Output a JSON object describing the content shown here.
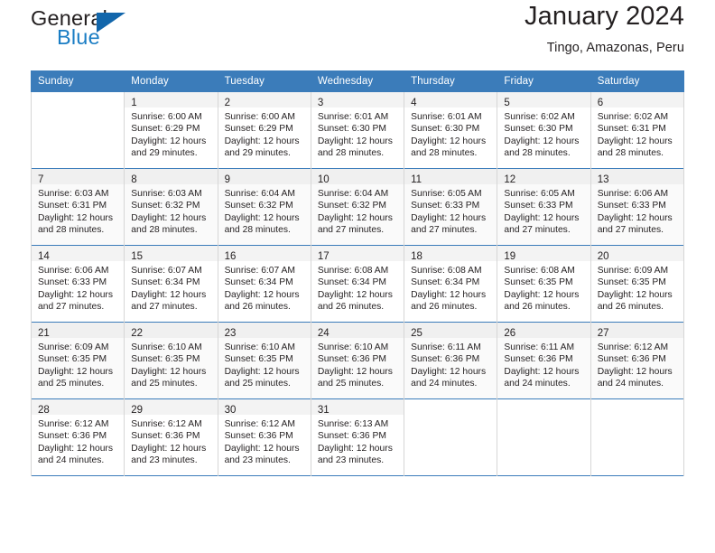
{
  "brand": {
    "word_one": "General",
    "word_two": "Blue",
    "logo_icon": "blue-triangle-logo"
  },
  "header": {
    "month_title": "January 2024",
    "location": "Tingo, Amazonas, Peru"
  },
  "calendar": {
    "weekday_headers": [
      "Sunday",
      "Monday",
      "Tuesday",
      "Wednesday",
      "Thursday",
      "Friday",
      "Saturday"
    ],
    "accent_color": "#3b7cba",
    "weeks": [
      [
        {
          "day": "",
          "lines": []
        },
        {
          "day": "1",
          "lines": [
            "Sunrise: 6:00 AM",
            "Sunset: 6:29 PM",
            "Daylight: 12 hours",
            "and 29 minutes."
          ]
        },
        {
          "day": "2",
          "lines": [
            "Sunrise: 6:00 AM",
            "Sunset: 6:29 PM",
            "Daylight: 12 hours",
            "and 29 minutes."
          ]
        },
        {
          "day": "3",
          "lines": [
            "Sunrise: 6:01 AM",
            "Sunset: 6:30 PM",
            "Daylight: 12 hours",
            "and 28 minutes."
          ]
        },
        {
          "day": "4",
          "lines": [
            "Sunrise: 6:01 AM",
            "Sunset: 6:30 PM",
            "Daylight: 12 hours",
            "and 28 minutes."
          ]
        },
        {
          "day": "5",
          "lines": [
            "Sunrise: 6:02 AM",
            "Sunset: 6:30 PM",
            "Daylight: 12 hours",
            "and 28 minutes."
          ]
        },
        {
          "day": "6",
          "lines": [
            "Sunrise: 6:02 AM",
            "Sunset: 6:31 PM",
            "Daylight: 12 hours",
            "and 28 minutes."
          ]
        }
      ],
      [
        {
          "day": "7",
          "lines": [
            "Sunrise: 6:03 AM",
            "Sunset: 6:31 PM",
            "Daylight: 12 hours",
            "and 28 minutes."
          ]
        },
        {
          "day": "8",
          "lines": [
            "Sunrise: 6:03 AM",
            "Sunset: 6:32 PM",
            "Daylight: 12 hours",
            "and 28 minutes."
          ]
        },
        {
          "day": "9",
          "lines": [
            "Sunrise: 6:04 AM",
            "Sunset: 6:32 PM",
            "Daylight: 12 hours",
            "and 28 minutes."
          ]
        },
        {
          "day": "10",
          "lines": [
            "Sunrise: 6:04 AM",
            "Sunset: 6:32 PM",
            "Daylight: 12 hours",
            "and 27 minutes."
          ]
        },
        {
          "day": "11",
          "lines": [
            "Sunrise: 6:05 AM",
            "Sunset: 6:33 PM",
            "Daylight: 12 hours",
            "and 27 minutes."
          ]
        },
        {
          "day": "12",
          "lines": [
            "Sunrise: 6:05 AM",
            "Sunset: 6:33 PM",
            "Daylight: 12 hours",
            "and 27 minutes."
          ]
        },
        {
          "day": "13",
          "lines": [
            "Sunrise: 6:06 AM",
            "Sunset: 6:33 PM",
            "Daylight: 12 hours",
            "and 27 minutes."
          ]
        }
      ],
      [
        {
          "day": "14",
          "lines": [
            "Sunrise: 6:06 AM",
            "Sunset: 6:33 PM",
            "Daylight: 12 hours",
            "and 27 minutes."
          ]
        },
        {
          "day": "15",
          "lines": [
            "Sunrise: 6:07 AM",
            "Sunset: 6:34 PM",
            "Daylight: 12 hours",
            "and 27 minutes."
          ]
        },
        {
          "day": "16",
          "lines": [
            "Sunrise: 6:07 AM",
            "Sunset: 6:34 PM",
            "Daylight: 12 hours",
            "and 26 minutes."
          ]
        },
        {
          "day": "17",
          "lines": [
            "Sunrise: 6:08 AM",
            "Sunset: 6:34 PM",
            "Daylight: 12 hours",
            "and 26 minutes."
          ]
        },
        {
          "day": "18",
          "lines": [
            "Sunrise: 6:08 AM",
            "Sunset: 6:34 PM",
            "Daylight: 12 hours",
            "and 26 minutes."
          ]
        },
        {
          "day": "19",
          "lines": [
            "Sunrise: 6:08 AM",
            "Sunset: 6:35 PM",
            "Daylight: 12 hours",
            "and 26 minutes."
          ]
        },
        {
          "day": "20",
          "lines": [
            "Sunrise: 6:09 AM",
            "Sunset: 6:35 PM",
            "Daylight: 12 hours",
            "and 26 minutes."
          ]
        }
      ],
      [
        {
          "day": "21",
          "lines": [
            "Sunrise: 6:09 AM",
            "Sunset: 6:35 PM",
            "Daylight: 12 hours",
            "and 25 minutes."
          ]
        },
        {
          "day": "22",
          "lines": [
            "Sunrise: 6:10 AM",
            "Sunset: 6:35 PM",
            "Daylight: 12 hours",
            "and 25 minutes."
          ]
        },
        {
          "day": "23",
          "lines": [
            "Sunrise: 6:10 AM",
            "Sunset: 6:35 PM",
            "Daylight: 12 hours",
            "and 25 minutes."
          ]
        },
        {
          "day": "24",
          "lines": [
            "Sunrise: 6:10 AM",
            "Sunset: 6:36 PM",
            "Daylight: 12 hours",
            "and 25 minutes."
          ]
        },
        {
          "day": "25",
          "lines": [
            "Sunrise: 6:11 AM",
            "Sunset: 6:36 PM",
            "Daylight: 12 hours",
            "and 24 minutes."
          ]
        },
        {
          "day": "26",
          "lines": [
            "Sunrise: 6:11 AM",
            "Sunset: 6:36 PM",
            "Daylight: 12 hours",
            "and 24 minutes."
          ]
        },
        {
          "day": "27",
          "lines": [
            "Sunrise: 6:12 AM",
            "Sunset: 6:36 PM",
            "Daylight: 12 hours",
            "and 24 minutes."
          ]
        }
      ],
      [
        {
          "day": "28",
          "lines": [
            "Sunrise: 6:12 AM",
            "Sunset: 6:36 PM",
            "Daylight: 12 hours",
            "and 24 minutes."
          ]
        },
        {
          "day": "29",
          "lines": [
            "Sunrise: 6:12 AM",
            "Sunset: 6:36 PM",
            "Daylight: 12 hours",
            "and 23 minutes."
          ]
        },
        {
          "day": "30",
          "lines": [
            "Sunrise: 6:12 AM",
            "Sunset: 6:36 PM",
            "Daylight: 12 hours",
            "and 23 minutes."
          ]
        },
        {
          "day": "31",
          "lines": [
            "Sunrise: 6:13 AM",
            "Sunset: 6:36 PM",
            "Daylight: 12 hours",
            "and 23 minutes."
          ]
        },
        {
          "day": "",
          "lines": []
        },
        {
          "day": "",
          "lines": []
        },
        {
          "day": "",
          "lines": []
        }
      ]
    ]
  }
}
